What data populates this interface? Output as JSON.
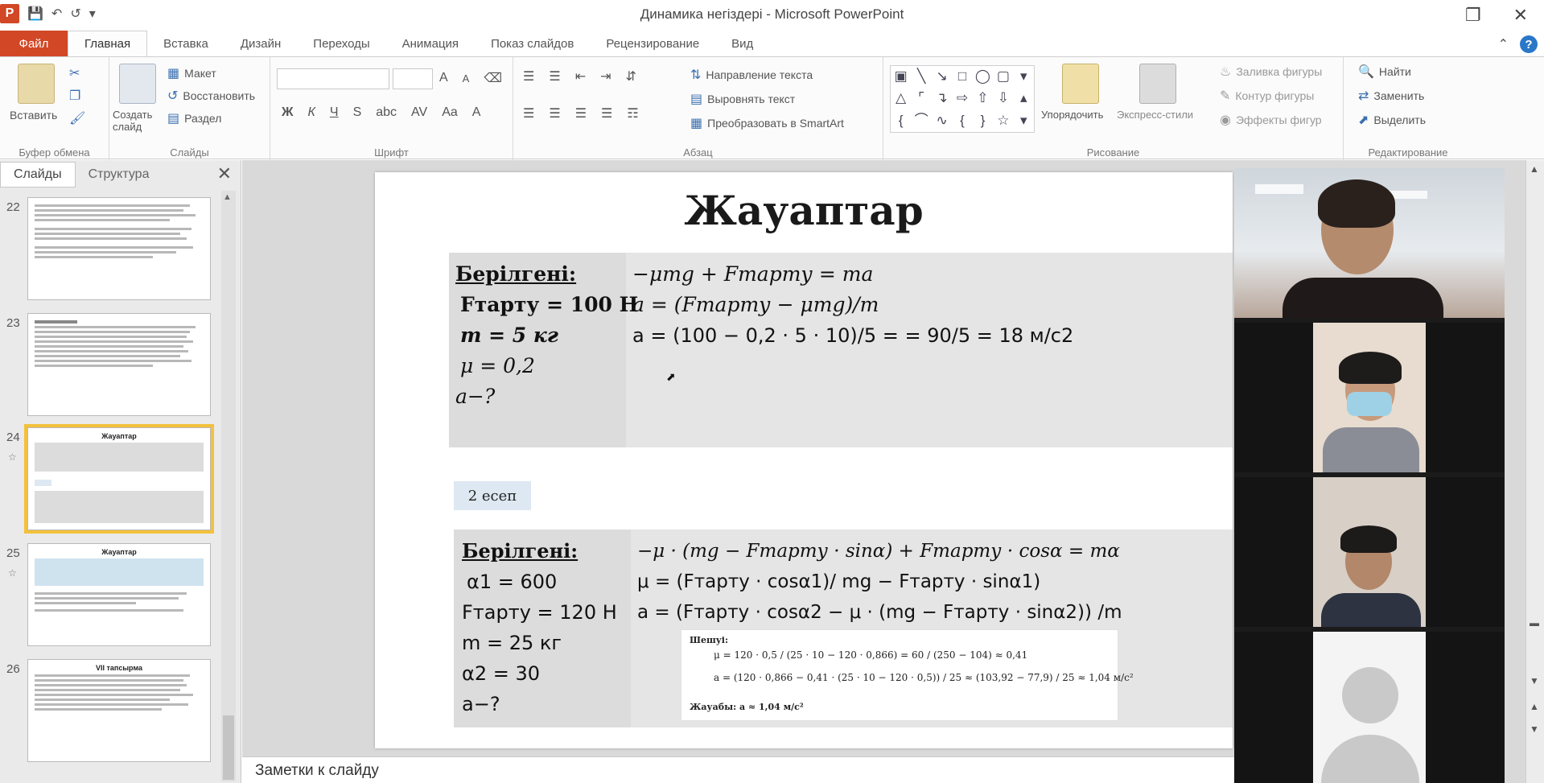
{
  "window": {
    "title": "Динамика негіздері - Microsoft PowerPoint",
    "app_letter": "P"
  },
  "ribbon_tabs": [
    {
      "label": "Файл"
    },
    {
      "label": "Главная"
    },
    {
      "label": "Вставка"
    },
    {
      "label": "Дизайн"
    },
    {
      "label": "Переходы"
    },
    {
      "label": "Анимация"
    },
    {
      "label": "Показ слайдов"
    },
    {
      "label": "Рецензирование"
    },
    {
      "label": "Вид"
    }
  ],
  "ribbon": {
    "clipboard": {
      "paste": "Вставить",
      "label": "Буфер обмена"
    },
    "slides": {
      "new_slide": "Создать слайд",
      "layout": "Макет",
      "reset": "Восстановить",
      "section": "Раздел",
      "label": "Слайды"
    },
    "font": {
      "label": "Шрифт",
      "bold": "Ж",
      "italic": "К",
      "underline": "Ч",
      "strike": "S",
      "size_up": "A",
      "size_down": "A"
    },
    "paragraph": {
      "label": "Абзац",
      "text_direction": "Направление текста",
      "align_text": "Выровнять текст",
      "smartart": "Преобразовать в SmartArt"
    },
    "drawing": {
      "label": "Рисование",
      "arrange": "Упорядочить",
      "quick_styles": "Экспресс-стили",
      "fill": "Заливка фигуры",
      "outline": "Контур фигуры",
      "effects": "Эффекты фигур"
    },
    "editing": {
      "label": "Редактирование",
      "find": "Найти",
      "replace": "Заменить",
      "select": "Выделить"
    }
  },
  "left_panel": {
    "tab_slides": "Слайды",
    "tab_outline": "Структура",
    "thumbnails": [
      {
        "num": "22",
        "title": ""
      },
      {
        "num": "23",
        "title": ""
      },
      {
        "num": "24",
        "title": "Жауаптар"
      },
      {
        "num": "25",
        "title": "Жауаптар"
      },
      {
        "num": "26",
        "title": "VII тапсырма"
      }
    ]
  },
  "slide": {
    "title": "Жауаптар",
    "task1": {
      "given_header": "Берілгені:",
      "given": [
        "Fтарту = 100 Н",
        "m = 5 кг",
        "μ = 0,2",
        "a−?"
      ],
      "formulas": [
        "−μmg + Fтарту = ma",
        "a = (Fтарту − μmg)/m",
        "a = (100 − 0,2 · 5 · 10)/5 = = 90/5 = 18 м/с2"
      ]
    },
    "tag": "2 есеп",
    "task2": {
      "given_header": "Берілгені:",
      "given": [
        "α1 = 600",
        "Fтарту = 120 Н",
        "m = 25 кг",
        "α2 = 30",
        "a−?"
      ],
      "formulas": [
        "−μ · (mg − Fтарту · sinα) + Fтарту · cosα = mα",
        "μ = (Fтарту · cosα1)/ mg − Fтарту · sinα1)",
        "a = (Fтарту · cosα2 − μ · (mg − Fтарту · sinα2)) /m"
      ]
    },
    "solution": {
      "label": "Шешуі:",
      "line1": "μ = 120 · 0,5 / (25 · 10 − 120 · 0,866) = 60 / (250 − 104) ≈ 0,41",
      "line2": "a = (120 · 0,866 − 0,41 · (25 · 10 − 120 · 0,5)) / 25 ≈ (103,92 − 77,9) / 25 ≈ 1,04 м/с²",
      "answer": "Жауабы: a ≈ 1,04 м/с²"
    }
  },
  "notes": {
    "placeholder": "Заметки к слайду"
  }
}
